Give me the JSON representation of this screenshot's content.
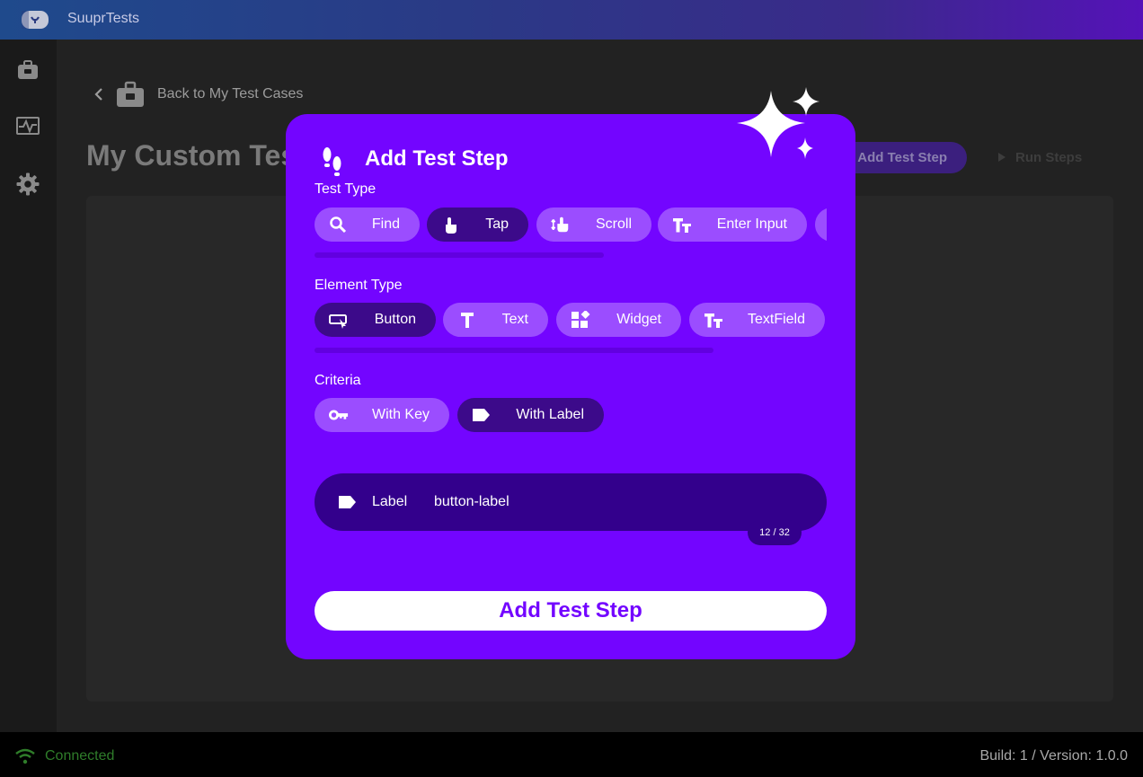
{
  "app": {
    "name": "SuuprTests"
  },
  "sidebar": {
    "items": [
      {
        "icon": "briefcase-icon"
      },
      {
        "icon": "activity-icon"
      },
      {
        "icon": "gear-icon"
      }
    ]
  },
  "main": {
    "back_label": "Back to My Test Cases",
    "title": "My Custom Test",
    "add_step_label": "Add Test Step",
    "run_steps_label": "Run Steps"
  },
  "modal": {
    "title": "Add Test Step",
    "test_type": {
      "label": "Test Type",
      "options": [
        {
          "label": "Find",
          "icon": "search-icon",
          "selected": false
        },
        {
          "label": "Tap",
          "icon": "tap-icon",
          "selected": true
        },
        {
          "label": "Scroll",
          "icon": "scroll-icon",
          "selected": false
        },
        {
          "label": "Enter Input",
          "icon": "text-size-icon",
          "selected": false
        }
      ]
    },
    "element_type": {
      "label": "Element Type",
      "options": [
        {
          "label": "Button",
          "icon": "button-icon",
          "selected": true
        },
        {
          "label": "Text",
          "icon": "text-icon",
          "selected": false
        },
        {
          "label": "Widget",
          "icon": "widget-icon",
          "selected": false
        },
        {
          "label": "TextField",
          "icon": "text-size-icon",
          "selected": false
        }
      ]
    },
    "criteria": {
      "label": "Criteria",
      "options": [
        {
          "label": "With Key",
          "icon": "key-icon",
          "selected": false
        },
        {
          "label": "With Label",
          "icon": "label-tag-icon",
          "selected": true
        }
      ]
    },
    "label_field": {
      "label": "Label",
      "value": "button-label",
      "counter": "12 / 32"
    },
    "submit_label": "Add Test Step"
  },
  "status": {
    "connection": "Connected",
    "build": "Build: 1 / Version: 1.0.0"
  },
  "colors": {
    "modal_bg": "#7305ff",
    "chip_bg": "#9b4dff",
    "chip_selected_bg": "#3c0a8a",
    "field_bg": "#33008c",
    "connected": "#2f7d2a"
  }
}
